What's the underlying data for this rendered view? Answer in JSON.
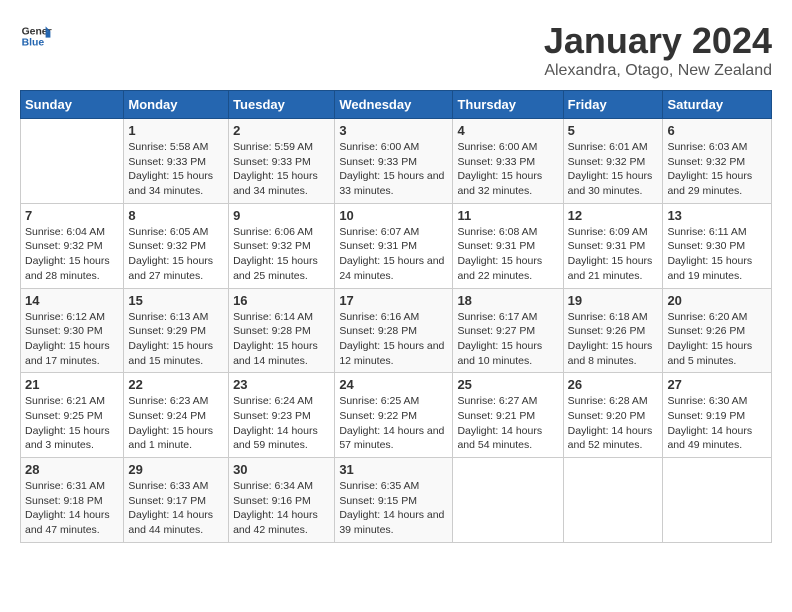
{
  "header": {
    "logo": {
      "general": "General",
      "blue": "Blue"
    },
    "title": "January 2024",
    "subtitle": "Alexandra, Otago, New Zealand"
  },
  "days_of_week": [
    "Sunday",
    "Monday",
    "Tuesday",
    "Wednesday",
    "Thursday",
    "Friday",
    "Saturday"
  ],
  "weeks": [
    [
      {
        "day": "",
        "sunrise": "",
        "sunset": "",
        "daylight": ""
      },
      {
        "day": "1",
        "sunrise": "5:58 AM",
        "sunset": "9:33 PM",
        "daylight": "15 hours and 34 minutes."
      },
      {
        "day": "2",
        "sunrise": "5:59 AM",
        "sunset": "9:33 PM",
        "daylight": "15 hours and 34 minutes."
      },
      {
        "day": "3",
        "sunrise": "6:00 AM",
        "sunset": "9:33 PM",
        "daylight": "15 hours and 33 minutes."
      },
      {
        "day": "4",
        "sunrise": "6:00 AM",
        "sunset": "9:33 PM",
        "daylight": "15 hours and 32 minutes."
      },
      {
        "day": "5",
        "sunrise": "6:01 AM",
        "sunset": "9:32 PM",
        "daylight": "15 hours and 30 minutes."
      },
      {
        "day": "6",
        "sunrise": "6:03 AM",
        "sunset": "9:32 PM",
        "daylight": "15 hours and 29 minutes."
      }
    ],
    [
      {
        "day": "7",
        "sunrise": "6:04 AM",
        "sunset": "9:32 PM",
        "daylight": "15 hours and 28 minutes."
      },
      {
        "day": "8",
        "sunrise": "6:05 AM",
        "sunset": "9:32 PM",
        "daylight": "15 hours and 27 minutes."
      },
      {
        "day": "9",
        "sunrise": "6:06 AM",
        "sunset": "9:32 PM",
        "daylight": "15 hours and 25 minutes."
      },
      {
        "day": "10",
        "sunrise": "6:07 AM",
        "sunset": "9:31 PM",
        "daylight": "15 hours and 24 minutes."
      },
      {
        "day": "11",
        "sunrise": "6:08 AM",
        "sunset": "9:31 PM",
        "daylight": "15 hours and 22 minutes."
      },
      {
        "day": "12",
        "sunrise": "6:09 AM",
        "sunset": "9:31 PM",
        "daylight": "15 hours and 21 minutes."
      },
      {
        "day": "13",
        "sunrise": "6:11 AM",
        "sunset": "9:30 PM",
        "daylight": "15 hours and 19 minutes."
      }
    ],
    [
      {
        "day": "14",
        "sunrise": "6:12 AM",
        "sunset": "9:30 PM",
        "daylight": "15 hours and 17 minutes."
      },
      {
        "day": "15",
        "sunrise": "6:13 AM",
        "sunset": "9:29 PM",
        "daylight": "15 hours and 15 minutes."
      },
      {
        "day": "16",
        "sunrise": "6:14 AM",
        "sunset": "9:28 PM",
        "daylight": "15 hours and 14 minutes."
      },
      {
        "day": "17",
        "sunrise": "6:16 AM",
        "sunset": "9:28 PM",
        "daylight": "15 hours and 12 minutes."
      },
      {
        "day": "18",
        "sunrise": "6:17 AM",
        "sunset": "9:27 PM",
        "daylight": "15 hours and 10 minutes."
      },
      {
        "day": "19",
        "sunrise": "6:18 AM",
        "sunset": "9:26 PM",
        "daylight": "15 hours and 8 minutes."
      },
      {
        "day": "20",
        "sunrise": "6:20 AM",
        "sunset": "9:26 PM",
        "daylight": "15 hours and 5 minutes."
      }
    ],
    [
      {
        "day": "21",
        "sunrise": "6:21 AM",
        "sunset": "9:25 PM",
        "daylight": "15 hours and 3 minutes."
      },
      {
        "day": "22",
        "sunrise": "6:23 AM",
        "sunset": "9:24 PM",
        "daylight": "15 hours and 1 minute."
      },
      {
        "day": "23",
        "sunrise": "6:24 AM",
        "sunset": "9:23 PM",
        "daylight": "14 hours and 59 minutes."
      },
      {
        "day": "24",
        "sunrise": "6:25 AM",
        "sunset": "9:22 PM",
        "daylight": "14 hours and 57 minutes."
      },
      {
        "day": "25",
        "sunrise": "6:27 AM",
        "sunset": "9:21 PM",
        "daylight": "14 hours and 54 minutes."
      },
      {
        "day": "26",
        "sunrise": "6:28 AM",
        "sunset": "9:20 PM",
        "daylight": "14 hours and 52 minutes."
      },
      {
        "day": "27",
        "sunrise": "6:30 AM",
        "sunset": "9:19 PM",
        "daylight": "14 hours and 49 minutes."
      }
    ],
    [
      {
        "day": "28",
        "sunrise": "6:31 AM",
        "sunset": "9:18 PM",
        "daylight": "14 hours and 47 minutes."
      },
      {
        "day": "29",
        "sunrise": "6:33 AM",
        "sunset": "9:17 PM",
        "daylight": "14 hours and 44 minutes."
      },
      {
        "day": "30",
        "sunrise": "6:34 AM",
        "sunset": "9:16 PM",
        "daylight": "14 hours and 42 minutes."
      },
      {
        "day": "31",
        "sunrise": "6:35 AM",
        "sunset": "9:15 PM",
        "daylight": "14 hours and 39 minutes."
      },
      {
        "day": "",
        "sunrise": "",
        "sunset": "",
        "daylight": ""
      },
      {
        "day": "",
        "sunrise": "",
        "sunset": "",
        "daylight": ""
      },
      {
        "day": "",
        "sunrise": "",
        "sunset": "",
        "daylight": ""
      }
    ]
  ]
}
